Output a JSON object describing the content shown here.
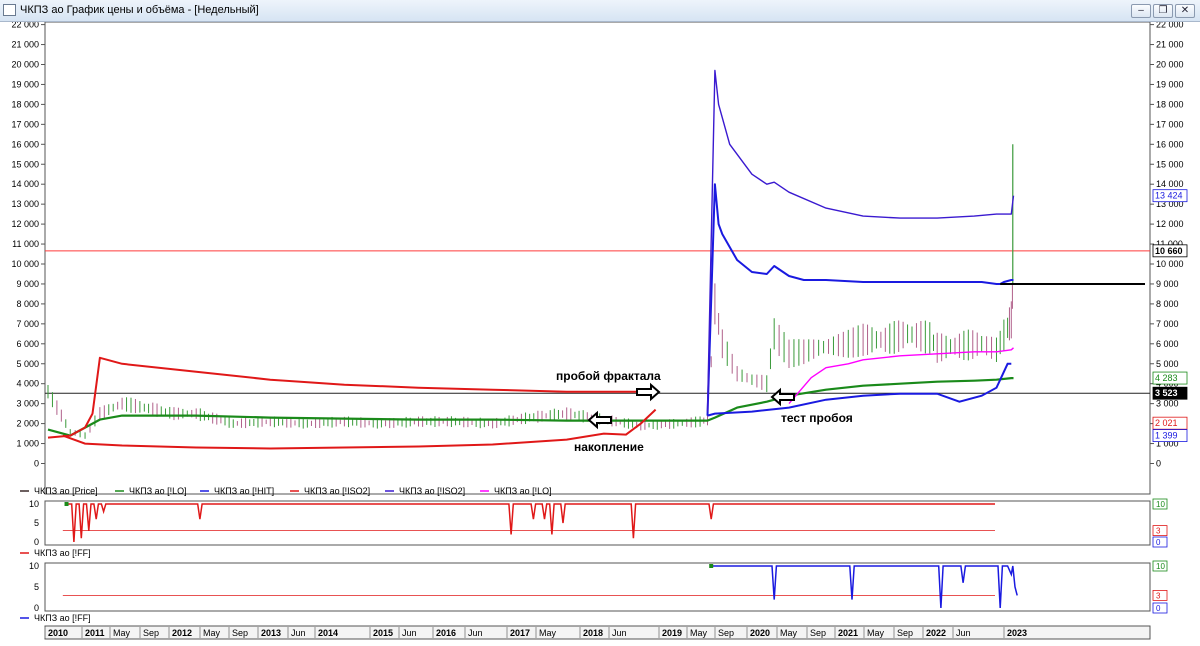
{
  "window": {
    "title": "ЧКПЗ ао График цены и объёма - [Недельный]",
    "minimize_icon": "minimize-icon",
    "restore_icon": "restore-icon",
    "close_icon": "close-icon"
  },
  "chart_data": [
    {
      "type": "line",
      "title": "",
      "x_labels": [
        "2010",
        "2011",
        "May",
        "Sep",
        "2012",
        "May",
        "Sep",
        "2013",
        "Jun",
        "2014",
        "2015",
        "Jun",
        "2016",
        "Jun",
        "2017",
        "May",
        "2018",
        "Jun",
        "2019",
        "May",
        "Sep",
        "2020",
        "May",
        "Sep",
        "2021",
        "May",
        "Sep",
        "2022",
        "Jun",
        "2023"
      ],
      "y_ticks": [
        "0",
        "1 000",
        "2 000",
        "3 000",
        "4 000",
        "5 000",
        "6 000",
        "7 000",
        "8 000",
        "9 000",
        "10 000",
        "11 000",
        "12 000",
        "13 000",
        "14 000",
        "15 000",
        "16 000",
        "17 000",
        "18 000",
        "19 000",
        "20 000",
        "21 000",
        "22 000"
      ],
      "ylim": [
        0,
        22000
      ],
      "grid": false,
      "legend_position": "bottom",
      "series": [
        {
          "name": "ЧКПЗ ао [Price]",
          "color": "#3c2a2a",
          "x": [
            2010.0,
            2010.3,
            2010.5,
            2010.7,
            2011.0,
            2011.3,
            2011.7,
            2012.0,
            2012.5,
            2013.0,
            2013.5,
            2014.0,
            2014.5,
            2015.0,
            2015.5,
            2016.0,
            2016.5,
            2017.0,
            2017.5,
            2018.0,
            2018.5,
            2018.8,
            2018.9,
            2019.0,
            2019.1,
            2019.3,
            2019.5,
            2019.7,
            2019.8,
            2020.0,
            2020.2,
            2020.4,
            2020.6,
            2020.8,
            2021.0,
            2021.3,
            2021.6,
            2021.9,
            2022.0,
            2022.3,
            2022.6,
            2022.8,
            2022.95,
            2023.0,
            2023.03
          ],
          "y": [
            3600,
            1600,
            1400,
            2500,
            3000,
            2800,
            2500,
            2500,
            2000,
            2100,
            2000,
            2100,
            2000,
            2100,
            2100,
            2000,
            2300,
            2500,
            2200,
            1900,
            2000,
            2100,
            2200,
            8000,
            6000,
            4500,
            4200,
            4000,
            6500,
            5500,
            5600,
            5800,
            5900,
            6000,
            6200,
            6200,
            6500,
            6300,
            5800,
            5900,
            6000,
            5700,
            6800,
            7200,
            9500
          ]
        },
        {
          "name": "ЧКПЗ ао [!LO]",
          "color": "#1a8a1a",
          "x": [
            2010.0,
            2010.3,
            2010.5,
            2010.7,
            2011.0,
            2012.0,
            2013.0,
            2014.0,
            2015.0,
            2016.0,
            2017.0,
            2018.0,
            2018.9,
            2019.0,
            2019.3,
            2019.7,
            2020.0,
            2020.5,
            2021.0,
            2021.5,
            2022.0,
            2022.5,
            2022.8,
            2023.0,
            2023.03
          ],
          "y": [
            1700,
            1400,
            1800,
            2200,
            2400,
            2400,
            2300,
            2250,
            2200,
            2200,
            2150,
            2150,
            2150,
            2300,
            2800,
            3100,
            3400,
            3700,
            3900,
            4000,
            4100,
            4150,
            4200,
            4280,
            4283
          ]
        },
        {
          "name": "ЧКПЗ ао [!HIT]",
          "color": "#1a1ae0",
          "x": [
            2018.9,
            2019.0,
            2019.05,
            2019.1,
            2019.3,
            2019.5,
            2019.7,
            2019.8,
            2020.0,
            2020.2,
            2020.5,
            2021.0,
            2021.5,
            2022.0,
            2022.3,
            2022.6,
            2022.8,
            2022.85,
            2022.9,
            2023.0,
            2023.03
          ],
          "y": [
            2400,
            14000,
            12000,
            11500,
            10200,
            9600,
            9500,
            9900,
            9400,
            9200,
            9200,
            9100,
            9100,
            9100,
            9100,
            9100,
            9000,
            9000,
            9100,
            9200,
            9200
          ]
        },
        {
          "name": "ЧКПЗ ао [!ISO2]",
          "color": "#e01818",
          "x": [
            2010.0,
            2010.3,
            2010.5,
            2010.6,
            2010.7,
            2011.0,
            2012.0,
            2013.0,
            2014.0,
            2015.0,
            2016.0,
            2017.0,
            2018.0,
            2018.2
          ],
          "y": [
            1300,
            1400,
            1800,
            2500,
            5300,
            5000,
            4600,
            4200,
            3950,
            3800,
            3700,
            3600,
            3600,
            3600
          ]
        },
        {
          "name": "ЧКПЗ ао [!ISO2]",
          "color": "#3a1ad0",
          "x": [
            2018.9,
            2019.0,
            2019.05,
            2019.2,
            2019.5,
            2019.7,
            2019.8,
            2020.0,
            2020.5,
            2021.0,
            2021.5,
            2022.0,
            2022.5,
            2022.8,
            2022.9,
            2023.0,
            2023.03
          ],
          "y": [
            2600,
            19700,
            18000,
            16000,
            14500,
            14000,
            14100,
            13600,
            12800,
            12400,
            12300,
            12300,
            12400,
            12500,
            12500,
            12500,
            13424
          ]
        },
        {
          "name": "ЧКПЗ ао [!LO]",
          "color": "#ff00ff",
          "x": [
            2020.0,
            2020.3,
            2020.5,
            2020.8,
            2021.0,
            2021.5,
            2022.0,
            2022.5,
            2022.8,
            2023.0,
            2023.03
          ],
          "y": [
            3000,
            4300,
            4800,
            5000,
            5200,
            5400,
            5500,
            5600,
            5600,
            5700,
            5800
          ]
        }
      ],
      "reference_lines": [
        {
          "y": 10660,
          "color": "#ff3a3a",
          "label": "10 660"
        },
        {
          "y": 3523,
          "color": "#222222",
          "label": "3 523"
        }
      ],
      "value_labels": [
        {
          "text": "13 424",
          "color": "#1a1ae0"
        },
        {
          "text": "4 283",
          "color": "#1a8a1a"
        },
        {
          "text": "2 021",
          "color": "#e01818"
        },
        {
          "text": "1 399",
          "color": "#1a1ae0"
        }
      ],
      "annotations": [
        "пробой фрактала",
        "накопление",
        "тест пробоя"
      ]
    },
    {
      "type": "line",
      "title": "",
      "y_ticks": [
        "0",
        "5",
        "10"
      ],
      "ylim": [
        0,
        10
      ],
      "series": [
        {
          "name": "ЧКПЗ ао [!FF]",
          "color": "#e01818"
        }
      ],
      "value_labels": [
        {
          "text": "10",
          "color": "#1a8a1a"
        },
        {
          "text": "3",
          "color": "#e01818"
        },
        {
          "text": "0",
          "color": "#1a1ae0"
        }
      ]
    },
    {
      "type": "line",
      "title": "",
      "y_ticks": [
        "0",
        "5",
        "10"
      ],
      "ylim": [
        0,
        10
      ],
      "series": [
        {
          "name": "ЧКПЗ ао [!FF]",
          "color": "#1a1ae0"
        }
      ],
      "value_labels": [
        {
          "text": "10",
          "color": "#1a8a1a"
        },
        {
          "text": "3",
          "color": "#e01818"
        },
        {
          "text": "0",
          "color": "#1a1ae0"
        }
      ]
    }
  ]
}
